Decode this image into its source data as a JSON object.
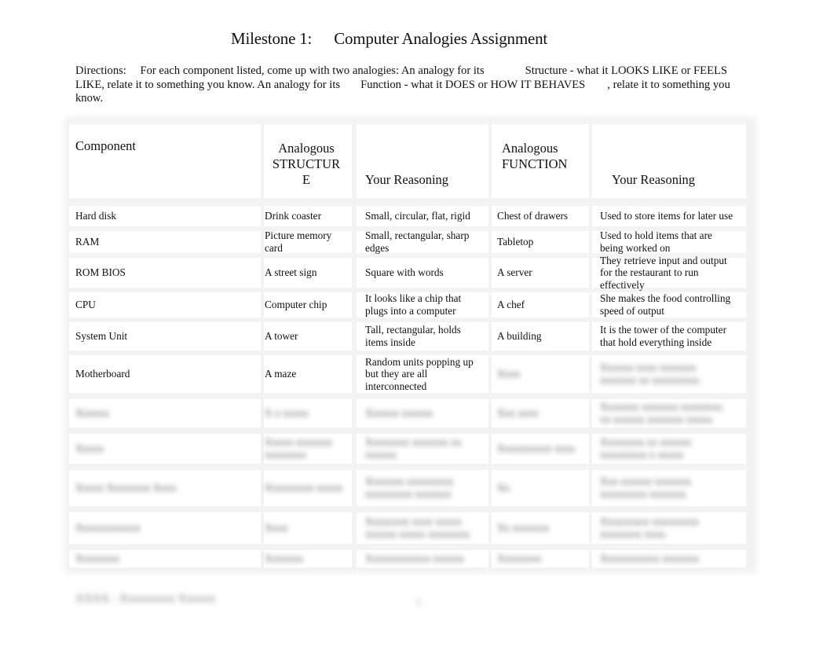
{
  "document": {
    "title_part1": "Milestone 1:",
    "title_part2": "Computer Analogies Assignment",
    "directions": {
      "label": "Directions:",
      "text1": "For each component listed, come up with two analogies: An analogy for its",
      "structure_phrase": "Structure - what it LOOKS LIKE or FEELS LIKE",
      "text2": ", relate it to something you know. An analogy for its",
      "function_phrase": "Function - what it DOES or HOW IT BEHAVES",
      "text3": ", relate it to something you know."
    }
  },
  "table": {
    "headers": {
      "component": "Component",
      "structure_line1": "Analogous",
      "structure_line2": "STRUCTUR",
      "structure_line3": "E",
      "reasoning1": "Your Reasoning",
      "function_line1": "Analogous",
      "function_line2": "FUNCTION",
      "reasoning2": "Your Reasoning"
    },
    "rows": [
      {
        "component": "Hard disk",
        "structure": "Drink coaster",
        "structure_reason": "Small, circular, flat, rigid",
        "function": "Chest of drawers",
        "function_reason": "Used to store items for later use"
      },
      {
        "component": "RAM",
        "structure": "Picture memory card",
        "structure_reason": "Small, rectangular, sharp edges",
        "function": "Tabletop",
        "function_reason": "Used to hold items that are being worked on"
      },
      {
        "component": "ROM BIOS",
        "structure": "A street sign",
        "structure_reason": "Square with words",
        "function": "A server",
        "function_reason": "They retrieve input and output for the restaurant to run effectively"
      },
      {
        "component": "CPU",
        "structure": "Computer chip",
        "structure_reason": "It looks like a chip that plugs into a computer",
        "function": "A chef",
        "function_reason": "She makes the food controlling speed of output"
      },
      {
        "component": "System Unit",
        "structure": "A tower",
        "structure_reason": "Tall, rectangular, holds items inside",
        "function": "A building",
        "function_reason": "It is the tower of the computer that hold everything inside"
      },
      {
        "component": "Motherboard",
        "structure": "A maze",
        "structure_reason": "Random units popping up but they are all interconnected",
        "function": "Xxxx",
        "function_reason": "Xxxxxx xxxx xxxxxxx xxxxxxx xx xxxxxxxxx"
      },
      {
        "component": "Xxxxxx",
        "structure": "X x xxxxx",
        "structure_reason": "Xxxxxx xxxxxx",
        "function": "Xxx xxxx",
        "function_reason": "Xxxxxxx xxxxxxx xxxxxxxx xx xxxxxx xxxxxxx xxxxx"
      },
      {
        "component": "Xxxxx",
        "structure": "Xxxxx xxxxxxx xxxxxxxx",
        "structure_reason": "Xxxxxxxx xxxxxxx xx xxxxxx",
        "function": "Xxxxxxxxxx xxxx",
        "function_reason": "Xxxxxxxx xx xxxxxx xxxxxxxxx x xxxxx"
      },
      {
        "component": "Xxxxx Xxxxxxxx Xxxx",
        "structure": "Xxxxxxxxx xxxxx",
        "structure_reason": "Xxxxxxx xxxxxxxxx xxxxxxxxx xxxxxxx",
        "function": "Xx",
        "function_reason": "Xxx xxxxxx xxxxxxx xxxxxxxxx xxxxxxx"
      },
      {
        "component": "Xxxxxxxxxxxx",
        "structure": "Xxxx",
        "structure_reason": "Xxxxxxxx xxxx xxxxx xxxxxx xxxxx xxxxxxxx",
        "function": "Xx xxxxxxx",
        "function_reason": "Xxxxxxxxx xxxxxxxxx xxxxxxxx xxxx"
      },
      {
        "component": "Xxxxxxxx",
        "structure": "Xxxxxxx",
        "structure_reason": "Xxxxxxxxxxxx xxxxxx",
        "function": "Xxxxxxxx",
        "function_reason": "Xxxxxxxxxxx xxxxxxx"
      }
    ]
  },
  "footer": {
    "text": "XXXX - Xxxxxxxxx Xxxxxx",
    "page": "1"
  }
}
